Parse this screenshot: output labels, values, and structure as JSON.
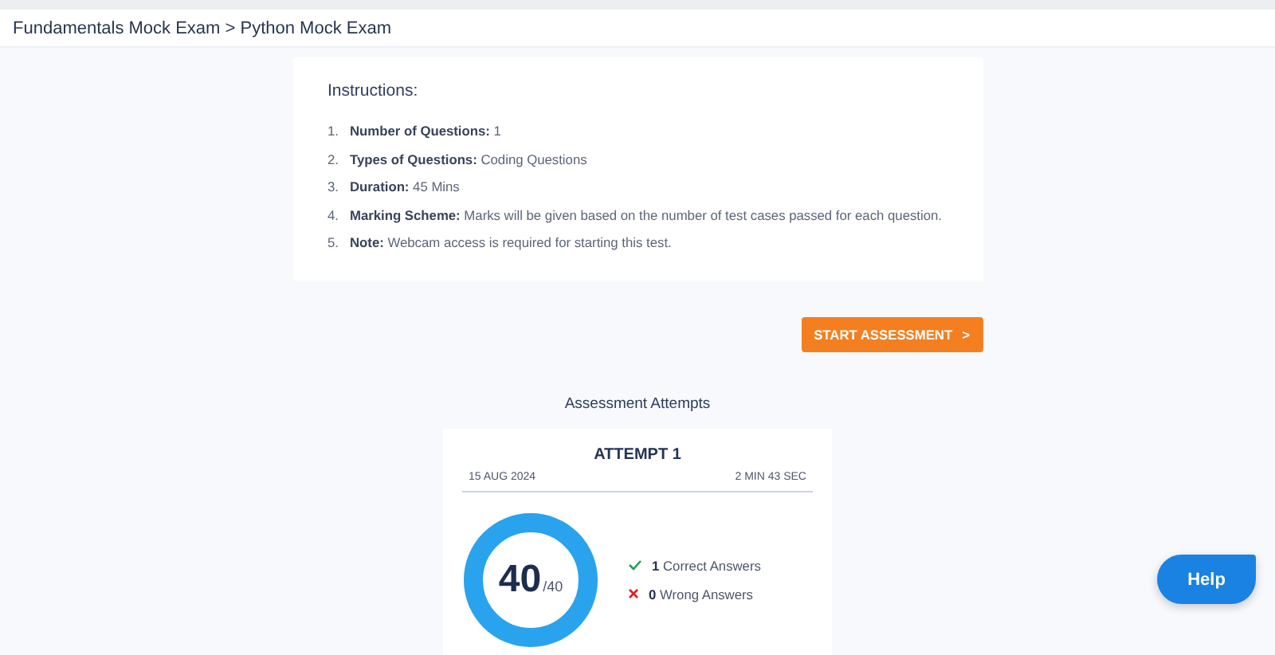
{
  "breadcrumb": "Fundamentals Mock Exam > Python Mock Exam",
  "instructions": {
    "title": "Instructions:",
    "items": [
      {
        "number": "1.",
        "text": "**Number of Questions:** 1"
      },
      {
        "number": "2.",
        "text": "**Types of Questions:** Coding Questions"
      },
      {
        "number": "3.",
        "text": "**Duration:** 45 Mins"
      },
      {
        "number": "4.",
        "text": "**Marking Scheme:** Marks will be given based on the number of test cases passed for each question."
      },
      {
        "number": "5.",
        "text": "**Note:** Webcam access is required for starting this test."
      }
    ]
  },
  "start_button": {
    "label": "START ASSESSMENT",
    "icon": ">"
  },
  "attempts": {
    "title": "Assessment Attempts",
    "items": [
      {
        "title": "ATTEMPT 1",
        "date": "15 AUG 2024",
        "duration": "2 MIN 43 SEC",
        "score": "40",
        "max": "/40",
        "level": 1,
        "results": [
          {
            "kind": "correct",
            "count": "1",
            "label": "Correct Answers"
          },
          {
            "kind": "wrong",
            "count": "0",
            "label": "Wrong Answers"
          }
        ]
      }
    ]
  },
  "help_button": {
    "label": "Help"
  }
}
